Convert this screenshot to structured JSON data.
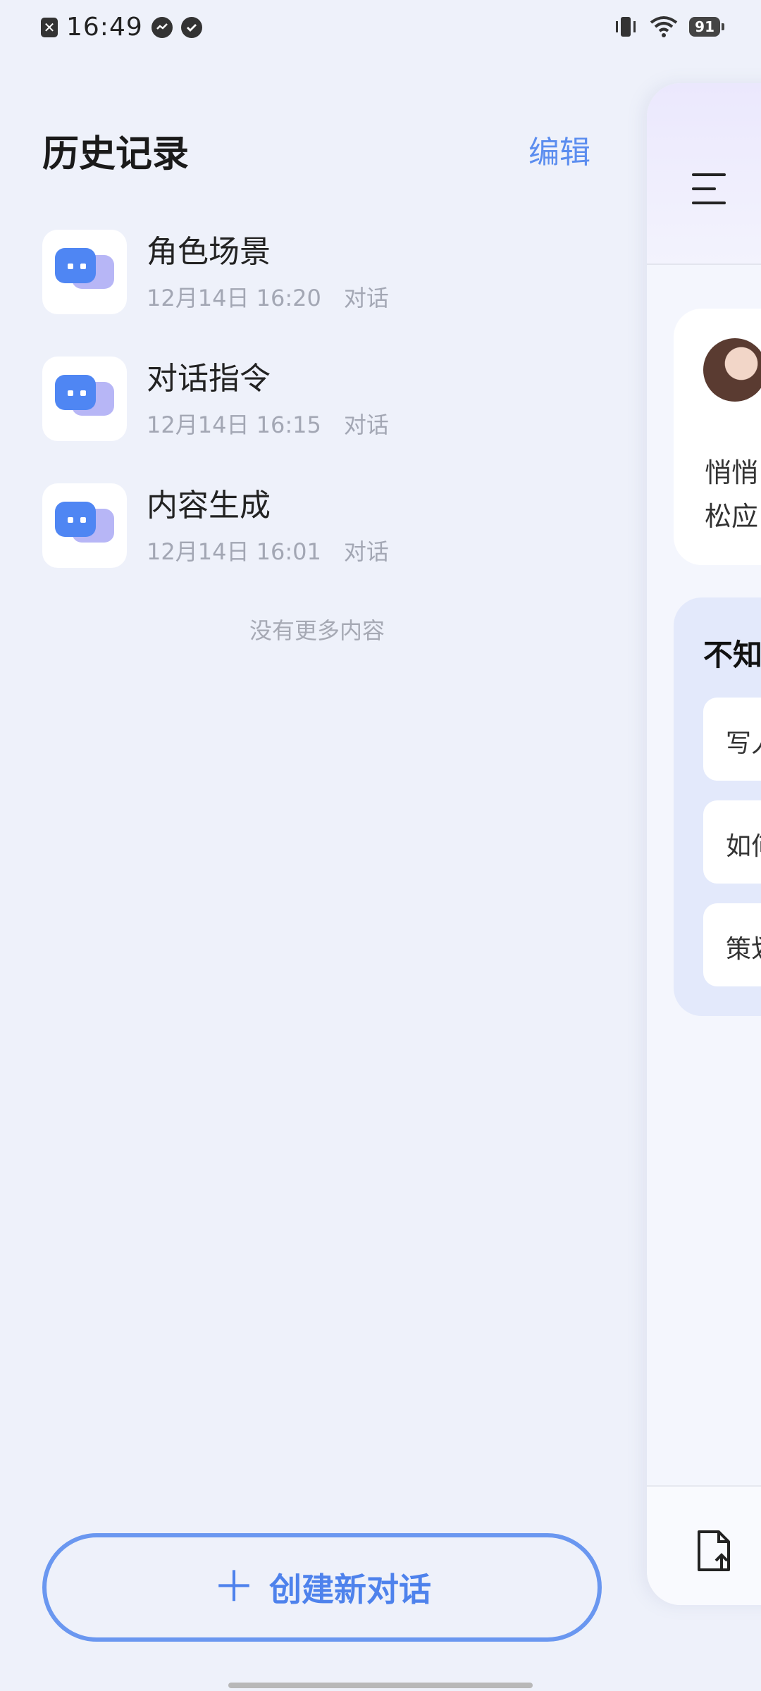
{
  "status": {
    "time": "16:49",
    "battery": "91"
  },
  "header": {
    "title": "历史记录",
    "edit_label": "编辑"
  },
  "history": [
    {
      "title": "角色场景",
      "date": "12月14日 16:20",
      "type": "对话"
    },
    {
      "title": "对话指令",
      "date": "12月14日 16:15",
      "type": "对话"
    },
    {
      "title": "内容生成",
      "date": "12月14日 16:01",
      "type": "对话"
    }
  ],
  "list_end": "没有更多内容",
  "new_chat": {
    "icon": "plus-icon",
    "label": "创建新对话"
  },
  "panel": {
    "intro_line1": "悄悄",
    "intro_line2": "松应",
    "suggest_title": "不知",
    "suggestions": [
      "写人",
      "如何",
      "策划"
    ]
  },
  "colors": {
    "accent": "#4e82ec",
    "background": "#eef1fa"
  }
}
